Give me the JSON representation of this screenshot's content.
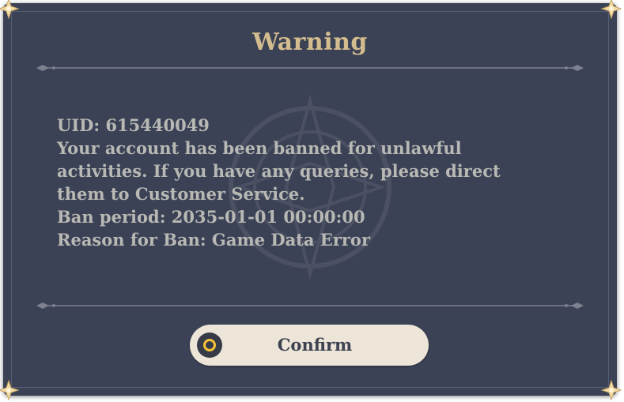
{
  "dialog": {
    "title": "Warning",
    "message_lines": [
      "UID: 615440049",
      "Your account has been banned for unlawful",
      "activities. If you have any queries, please direct",
      "them to Customer Service.",
      "Ban period: 2035-01-01 00:00:00",
      "Reason for Ban: Game Data Error"
    ],
    "confirm_label": "Confirm"
  },
  "colors": {
    "panel_background": "#3b4255",
    "title_gold": "#d3bc8e",
    "message_text": "#b8b8b4",
    "button_background": "#ece5d8",
    "button_icon_ring": "#f5c436"
  },
  "icons": {
    "confirm": "circle-confirm-icon",
    "corners": "corner-ornament-icon"
  }
}
